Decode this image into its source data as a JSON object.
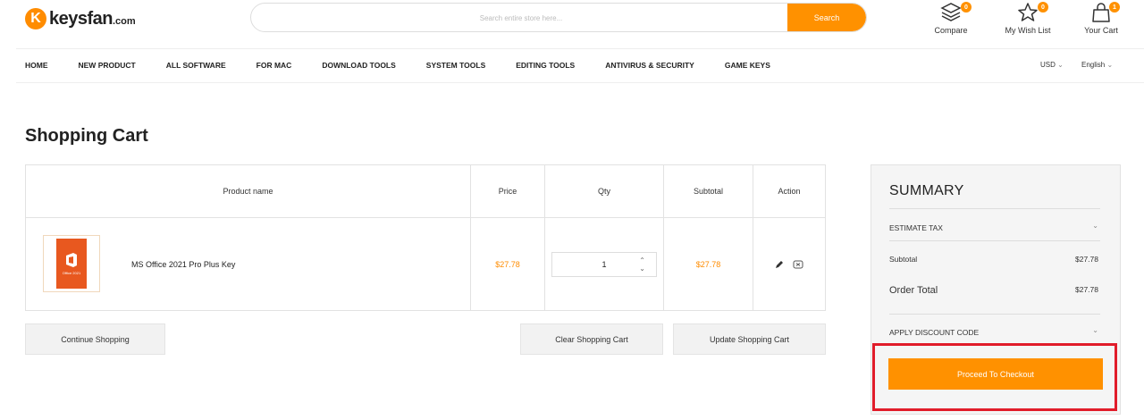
{
  "logo": {
    "letter": "K",
    "name": "keysfan",
    "suffix": ".com"
  },
  "search": {
    "placeholder": "Search entire store here...",
    "button_label": "Search"
  },
  "header_icons": [
    {
      "label": "Compare",
      "count": "0"
    },
    {
      "label": "My Wish List",
      "count": "0"
    },
    {
      "label": "Your Cart",
      "count": "1"
    }
  ],
  "nav": {
    "items": [
      "HOME",
      "NEW PRODUCT",
      "ALL SOFTWARE",
      "FOR MAC",
      "DOWNLOAD TOOLS",
      "SYSTEM TOOLS",
      "EDITING TOOLS",
      "ANTIVIRUS & SECURITY",
      "GAME KEYS"
    ],
    "currency": "USD",
    "language": "English"
  },
  "page_title": "Shopping Cart",
  "cart": {
    "headers": {
      "product": "Product name",
      "price": "Price",
      "qty": "Qty",
      "subtotal": "Subtotal",
      "action": "Action"
    },
    "items": [
      {
        "name": "MS Office 2021 Pro Plus Key",
        "price": "$27.78",
        "qty": "1",
        "subtotal": "$27.78",
        "image_label": "Office 2021"
      }
    ],
    "buttons": {
      "continue": "Continue Shopping",
      "clear": "Clear Shopping Cart",
      "update": "Update Shopping Cart"
    }
  },
  "summary": {
    "title": "SUMMARY",
    "estimate_tax": "ESTIMATE TAX",
    "subtotal_label": "Subtotal",
    "subtotal_value": "$27.78",
    "order_total_label": "Order Total",
    "order_total_value": "$27.78",
    "discount_label": "APPLY DISCOUNT CODE",
    "checkout_label": "Proceed To Checkout"
  },
  "colors": {
    "accent": "#ff9100",
    "highlight": "#e11c2a"
  }
}
